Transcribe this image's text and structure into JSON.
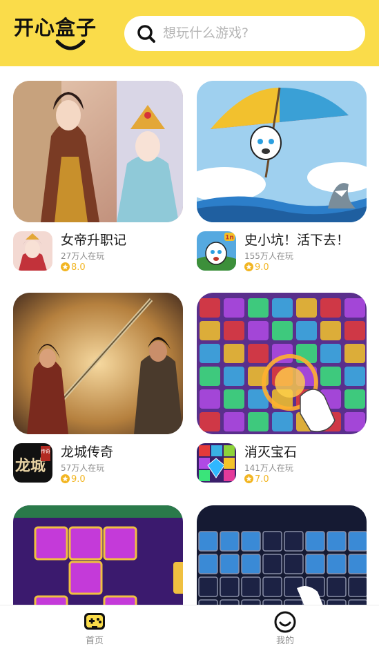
{
  "header": {
    "logo_text": "开心盒子",
    "search_placeholder": "想玩什么游戏?"
  },
  "games": [
    {
      "title": "女帝升职记",
      "players": "27万人在玩",
      "rating": "8.0"
    },
    {
      "title": "史小坑！活下去！",
      "players": "155万人在玩",
      "rating": "9.0",
      "icon_badge": "1n"
    },
    {
      "title": "龙城传奇",
      "players": "57万人在玩",
      "rating": "9.0",
      "icon_text_main": "龙城",
      "icon_text_tag": "传奇"
    },
    {
      "title": "消灭宝石",
      "players": "141万人在玩",
      "rating": "7.0"
    },
    {
      "title": "",
      "players": "",
      "rating": ""
    },
    {
      "title": "",
      "players": "",
      "rating": ""
    }
  ],
  "tabbar": {
    "home_label": "首页",
    "mine_label": "我的"
  },
  "colors": {
    "brand_yellow": "#fadc4a",
    "rating_gold": "#f2b521"
  }
}
